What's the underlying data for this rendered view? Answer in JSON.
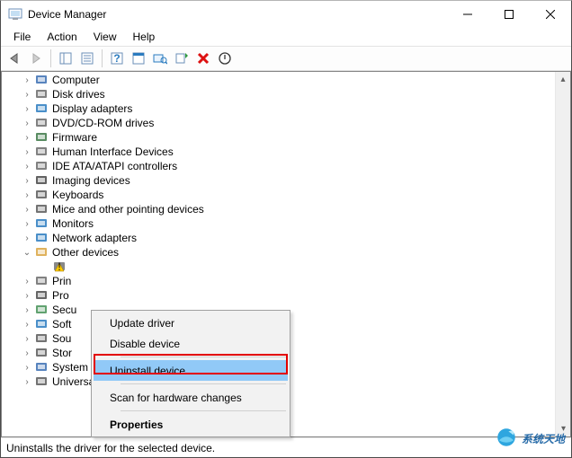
{
  "window": {
    "title": "Device Manager"
  },
  "menubar": {
    "items": [
      "File",
      "Action",
      "View",
      "Help"
    ]
  },
  "tree": {
    "items": [
      {
        "label": "Computer",
        "expander": ">",
        "iconColor": "#3b6fb3"
      },
      {
        "label": "Disk drives",
        "expander": ">",
        "iconColor": "#6b6b6b"
      },
      {
        "label": "Display adapters",
        "expander": ">",
        "iconColor": "#2a7bbf"
      },
      {
        "label": "DVD/CD-ROM drives",
        "expander": ">",
        "iconColor": "#6b6b6b"
      },
      {
        "label": "Firmware",
        "expander": ">",
        "iconColor": "#3C7846"
      },
      {
        "label": "Human Interface Devices",
        "expander": ">",
        "iconColor": "#6b6b6b"
      },
      {
        "label": "IDE ATA/ATAPI controllers",
        "expander": ">",
        "iconColor": "#6b6b6b"
      },
      {
        "label": "Imaging devices",
        "expander": ">",
        "iconColor": "#474747"
      },
      {
        "label": "Keyboards",
        "expander": ">",
        "iconColor": "#5a5a5a"
      },
      {
        "label": "Mice and other pointing devices",
        "expander": ">",
        "iconColor": "#5a5a5a"
      },
      {
        "label": "Monitors",
        "expander": ">",
        "iconColor": "#2a7bbf"
      },
      {
        "label": "Network adapters",
        "expander": ">",
        "iconColor": "#2a7bbf"
      },
      {
        "label": "Other devices",
        "expander": "v",
        "iconColor": "#D9A441"
      }
    ],
    "truncated_items": [
      {
        "label": "Prin",
        "iconColor": "#6b6b6b"
      },
      {
        "label": "Pro",
        "iconColor": "#4b4b4b"
      },
      {
        "label": "Secu",
        "iconColor": "#459257"
      },
      {
        "label": "Soft",
        "iconColor": "#2a7bbf"
      },
      {
        "label": "Sou",
        "iconColor": "#5a5a5a"
      },
      {
        "label": "Stor",
        "iconColor": "#5a5a5a"
      }
    ],
    "after_items": [
      {
        "label": "System devices",
        "iconColor": "#3b6fb3"
      },
      {
        "label": "Universal Serial Bus controllers",
        "iconColor": "#5a5a5a"
      }
    ]
  },
  "context_menu": {
    "items": [
      {
        "label": "Update driver",
        "highlighted": false
      },
      {
        "label": "Disable device",
        "highlighted": false
      },
      {
        "sep": true
      },
      {
        "label": "Uninstall device",
        "highlighted": true
      },
      {
        "sep": true
      },
      {
        "label": "Scan for hardware changes",
        "highlighted": false
      },
      {
        "sep": true
      },
      {
        "label": "Properties",
        "bold": true,
        "highlighted": false
      }
    ]
  },
  "statusbar": {
    "text": "Uninstalls the driver for the selected device."
  },
  "watermark": {
    "text": "系统天地"
  }
}
